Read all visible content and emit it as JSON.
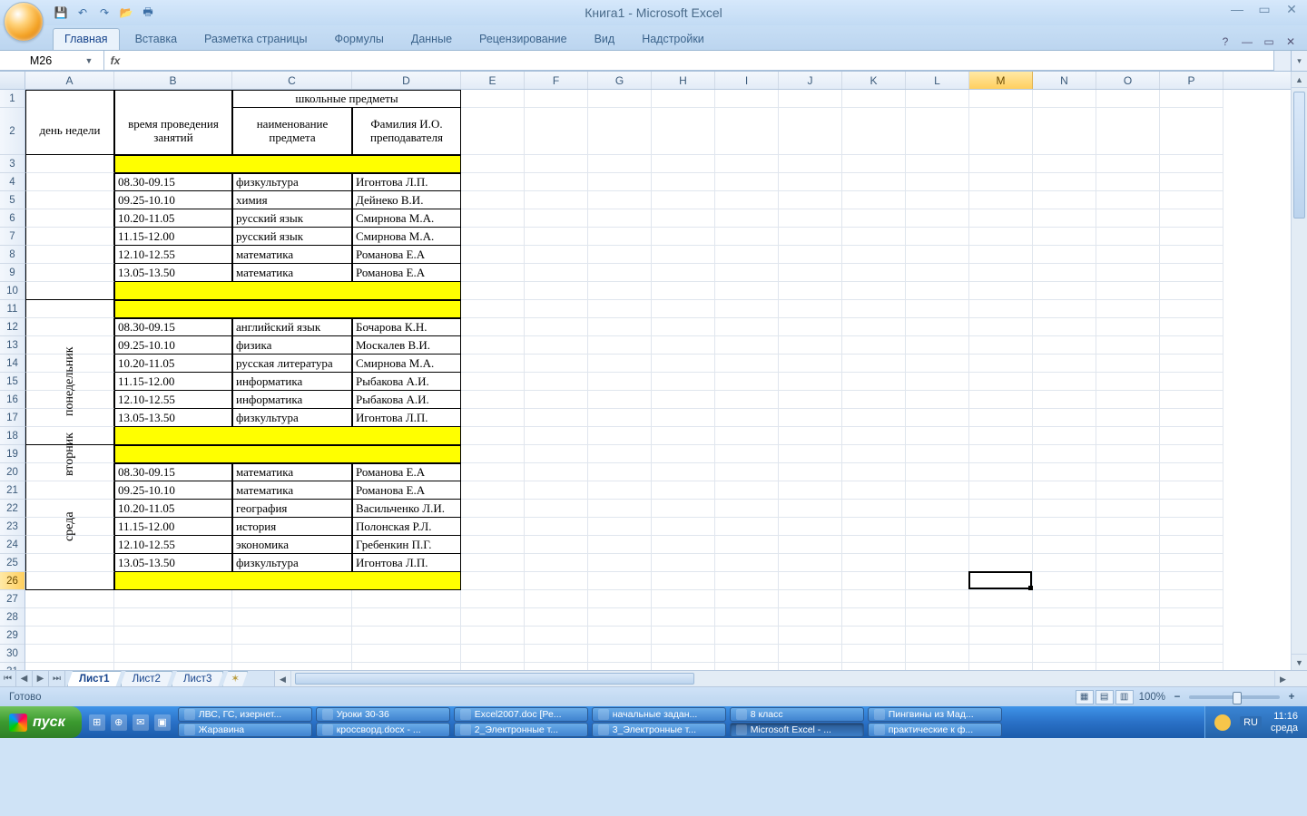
{
  "title": "Книга1 - Microsoft Excel",
  "qat": {
    "save": "💾",
    "undo": "↶",
    "redo": "↷",
    "open": "📂",
    "print": "🖶"
  },
  "ribbon": {
    "tabs": [
      "Главная",
      "Вставка",
      "Разметка страницы",
      "Формулы",
      "Данные",
      "Рецензирование",
      "Вид",
      "Надстройки"
    ],
    "active": 0,
    "help": "?"
  },
  "namebox": "M26",
  "columns": [
    "A",
    "B",
    "C",
    "D",
    "E",
    "F",
    "G",
    "H",
    "I",
    "J",
    "K",
    "L",
    "M",
    "N",
    "O",
    "P"
  ],
  "selected_col": "M",
  "selected_row": 26,
  "headers": {
    "day": "день недели",
    "time": "время проведения занятий",
    "subjects_group": "школьные предметы",
    "subject": "наименование предмета",
    "teacher": "Фамилия И.О. преподавателя"
  },
  "days": [
    {
      "name": "понедельник",
      "rows": [
        {
          "t": "08.30-09.15",
          "s": "физкультура",
          "p": "Игонтова Л.П."
        },
        {
          "t": "09.25-10.10",
          "s": "химия",
          "p": "Дейнеко В.И."
        },
        {
          "t": "10.20-11.05",
          "s": "русский язык",
          "p": "Смирнова М.А."
        },
        {
          "t": "11.15-12.00",
          "s": "русский язык",
          "p": "Смирнова М.А."
        },
        {
          "t": "12.10-12.55",
          "s": "математика",
          "p": "Романова Е.А"
        },
        {
          "t": "13.05-13.50",
          "s": "математика",
          "p": "Романова Е.А"
        }
      ]
    },
    {
      "name": "вторник",
      "rows": [
        {
          "t": "08.30-09.15",
          "s": "английский язык",
          "p": "Бочарова К.Н."
        },
        {
          "t": "09.25-10.10",
          "s": "физика",
          "p": "Москалев В.И."
        },
        {
          "t": "10.20-11.05",
          "s": "русская литература",
          "p": "Смирнова М.А."
        },
        {
          "t": "11.15-12.00",
          "s": "информатика",
          "p": "Рыбакова А.И."
        },
        {
          "t": "12.10-12.55",
          "s": "информатика",
          "p": "Рыбакова А.И."
        },
        {
          "t": "13.05-13.50",
          "s": "физкультура",
          "p": "Игонтова Л.П."
        }
      ]
    },
    {
      "name": "среда",
      "rows": [
        {
          "t": "08.30-09.15",
          "s": "математика",
          "p": "Романова Е.А"
        },
        {
          "t": "09.25-10.10",
          "s": "математика",
          "p": "Романова Е.А"
        },
        {
          "t": "10.20-11.05",
          "s": "география",
          "p": "Васильченко Л.И."
        },
        {
          "t": "11.15-12.00",
          "s": "история",
          "p": "Полонская Р.Л."
        },
        {
          "t": "12.10-12.55",
          "s": "экономика",
          "p": "Гребенкин П.Г."
        },
        {
          "t": "13.05-13.50",
          "s": "физкультура",
          "p": "Игонтова Л.П."
        }
      ]
    }
  ],
  "sheet_tabs": [
    "Лист1",
    "Лист2",
    "Лист3"
  ],
  "active_sheet": 0,
  "status": {
    "ready": "Готово",
    "zoom": "100%"
  },
  "taskbar": {
    "start": "пуск",
    "row1": [
      {
        "t": "ЛВС, ГС, изернет..."
      },
      {
        "t": "Уроки 30-36"
      },
      {
        "t": "Excel2007.doc [Ре..."
      },
      {
        "t": "начальные задан..."
      },
      {
        "t": "8 класс"
      },
      {
        "t": "Пингвины из Мад..."
      }
    ],
    "row2": [
      {
        "t": "Жаравина"
      },
      {
        "t": "кроссворд.docx - ..."
      },
      {
        "t": "2_Электронные т..."
      },
      {
        "t": "3_Электронные т..."
      },
      {
        "t": "Microsoft Excel - ...",
        "active": true
      },
      {
        "t": "практические к ф..."
      }
    ],
    "lang": "RU",
    "time": "11:16",
    "day": "среда"
  }
}
